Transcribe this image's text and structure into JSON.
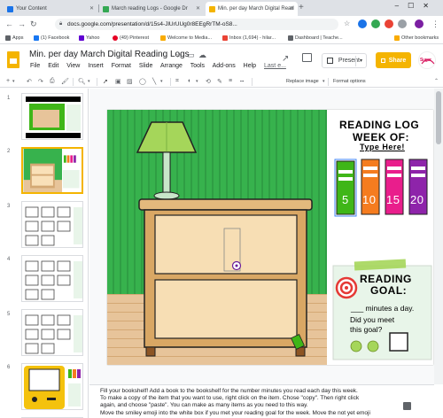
{
  "browser": {
    "tabs": [
      {
        "title": "Your Content"
      },
      {
        "title": "March reading Logs - Google Dr"
      },
      {
        "title": "Min. per day March Digital Read"
      }
    ],
    "url": "docs.google.com/presentation/d/15s4-JlUrUUg0r8EEgRrTM-oS8...",
    "bookmarks": [
      {
        "label": "Apps"
      },
      {
        "label": "(1) Facebook"
      },
      {
        "label": "Yahoo"
      },
      {
        "label": "(49) Pinterest"
      },
      {
        "label": "Welcome to Media..."
      },
      {
        "label": "Inbox (1,694) - hilar..."
      },
      {
        "label": "Dashboard | Teache..."
      },
      {
        "label": "Other bookmarks"
      }
    ]
  },
  "doc": {
    "title": "Min. per day March Digital Reading Logs",
    "menu": [
      "File",
      "Edit",
      "View",
      "Insert",
      "Format",
      "Slide",
      "Arrange",
      "Tools",
      "Add-ons",
      "Help"
    ],
    "last_edit": "Last e...",
    "present_label": "Present",
    "share_label": "Share",
    "avatar_text": "Sugar"
  },
  "toolbar": {
    "replace_image": "Replace image",
    "format_options": "Format options"
  },
  "filmstrip": {
    "numbers": [
      "1",
      "2",
      "3",
      "4",
      "5",
      "6"
    ]
  },
  "slide": {
    "reading_log_title": "READING LOG",
    "week_of": "WEEK OF:",
    "type_here": "Type Here!",
    "minutes": [
      "5",
      "10",
      "15",
      "20"
    ],
    "minute_colors": [
      "#3fb618",
      "#f57c1f",
      "#e91e8c",
      "#8e24aa"
    ],
    "goal_title_1": "READING",
    "goal_title_2": "GOAL:",
    "goal_line": "___ minutes a day.",
    "did_you_meet": "Did you meet",
    "this_goal": "this goal?"
  },
  "notes": {
    "lines": [
      "Fill your bookshelf!  Add a book to the bookshelf for the number minutes you read each day this week.",
      "To make a copy of the item that you want to use, right click on the item. Chose \"copy\".  Then right click",
      "again, and choose \"paste\".  You can make as many items as you need to this way.",
      "Move the smiley emoji  into the white box if you met your reading goal for the week.  Move the not yet emoji"
    ]
  }
}
